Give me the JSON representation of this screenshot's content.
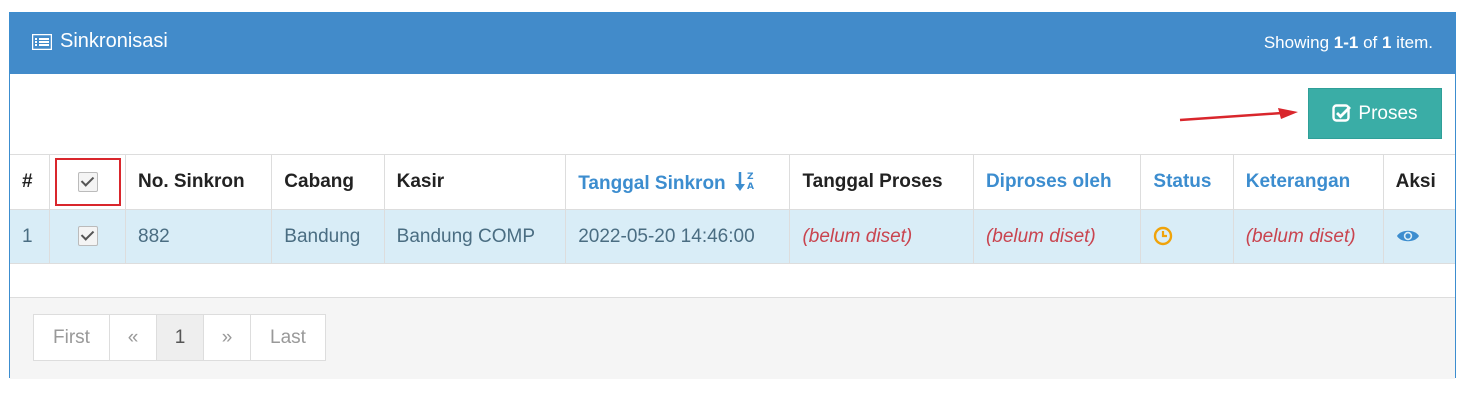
{
  "header": {
    "title": "Sinkronisasi",
    "summary_prefix": "Showing ",
    "summary_range": "1-1",
    "summary_mid": " of ",
    "summary_total": "1",
    "summary_suffix": " item."
  },
  "toolbar": {
    "proses_label": "Proses"
  },
  "table": {
    "columns": [
      "#",
      "",
      "No. Sinkron",
      "Cabang",
      "Kasir",
      "Tanggal Sinkron",
      "Tanggal Proses",
      "Diproses oleh",
      "Status",
      "Keterangan",
      "Aksi"
    ],
    "rows": [
      {
        "index": "1",
        "no_sinkron": "882",
        "cabang": "Bandung",
        "kasir": "Bandung COMP",
        "tanggal_sinkron": "2022-05-20 14:46:00",
        "tanggal_proses": "(belum diset)",
        "diproses_oleh": "(belum diset)",
        "status_icon": "clock-icon",
        "keterangan": "(belum diset)",
        "aksi_icon": "eye-icon"
      }
    ]
  },
  "pagination": {
    "first": "First",
    "prev": "«",
    "current": "1",
    "next": "»",
    "last": "Last"
  },
  "colors": {
    "header_bg": "#428bca",
    "button_bg": "#3aada6",
    "selected_row_bg": "#d9edf7",
    "unset_text": "#c9444f",
    "status_pending": "#f0a30a",
    "arrow": "#d9262c"
  }
}
